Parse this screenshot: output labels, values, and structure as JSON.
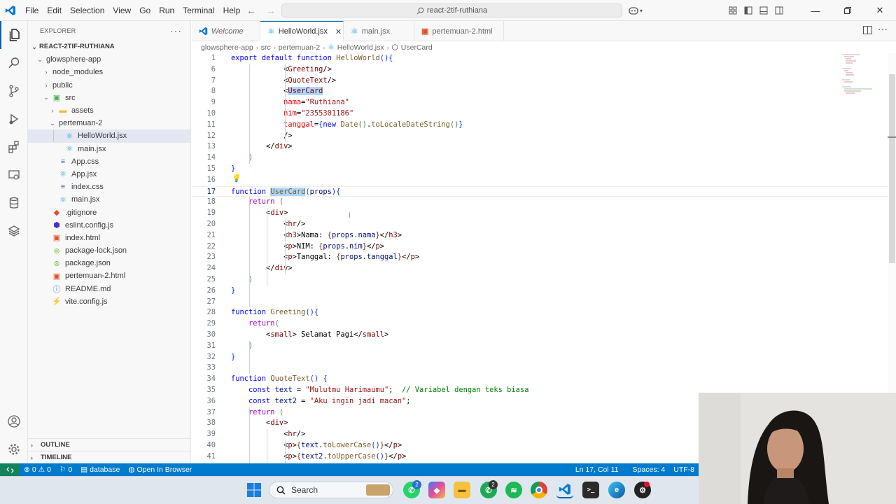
{
  "menu": [
    "File",
    "Edit",
    "Selection",
    "View",
    "Go",
    "Run",
    "Terminal",
    "Help"
  ],
  "command_center": "react-2tif-ruthiana",
  "explorer": {
    "title": "EXPLORER",
    "root": "REACT-2TIF-RUTHIANA",
    "items": [
      {
        "name": "glowsphere-app",
        "depth": 0,
        "type": "folder",
        "open": true
      },
      {
        "name": "node_modules",
        "depth": 1,
        "type": "folder",
        "open": false
      },
      {
        "name": "public",
        "depth": 1,
        "type": "folder",
        "open": false
      },
      {
        "name": "src",
        "depth": 1,
        "type": "folder-src",
        "open": true
      },
      {
        "name": "assets",
        "depth": 2,
        "type": "folder-assets",
        "open": false
      },
      {
        "name": "pertemuan-2",
        "depth": 2,
        "type": "folder",
        "open": true
      },
      {
        "name": "HelloWorld.jsx",
        "depth": 3,
        "type": "react",
        "selected": true
      },
      {
        "name": "main.jsx",
        "depth": 3,
        "type": "react"
      },
      {
        "name": "App.css",
        "depth": 2,
        "type": "css"
      },
      {
        "name": "App.jsx",
        "depth": 2,
        "type": "react"
      },
      {
        "name": "index.css",
        "depth": 2,
        "type": "css"
      },
      {
        "name": "main.jsx",
        "depth": 2,
        "type": "react"
      },
      {
        "name": ".gitignore",
        "depth": 1,
        "type": "git"
      },
      {
        "name": "eslint.config.js",
        "depth": 1,
        "type": "eslint"
      },
      {
        "name": "index.html",
        "depth": 1,
        "type": "html"
      },
      {
        "name": "package-lock.json",
        "depth": 1,
        "type": "npm"
      },
      {
        "name": "package.json",
        "depth": 1,
        "type": "npm"
      },
      {
        "name": "pertemuan-2.html",
        "depth": 1,
        "type": "html"
      },
      {
        "name": "README.md",
        "depth": 1,
        "type": "info"
      },
      {
        "name": "vite.config.js",
        "depth": 1,
        "type": "vite"
      }
    ],
    "outline": "OUTLINE",
    "timeline": "TIMELINE"
  },
  "tabs": [
    {
      "label": "Welcome",
      "icon": "vscode-icon",
      "italic": true
    },
    {
      "label": "HelloWorld.jsx",
      "icon": "react-icon",
      "active": true,
      "close": "✕"
    },
    {
      "label": "main.jsx",
      "icon": "react-icon"
    },
    {
      "label": "pertemuan-2.html",
      "icon": "html-icon"
    }
  ],
  "breadcrumb": [
    "glowsphere-app",
    "src",
    "pertemuan-2",
    "HelloWorld.jsx",
    "UserCard"
  ],
  "editor": {
    "current_line": 17,
    "lines": [
      {
        "n": "1",
        "html": "<span class='k'>export</span> <span class='k'>default</span> <span class='k'>function</span> <span class='f'>HelloWorld</span><span class='b1'>()</span><span class='b1'>{</span>"
      },
      {
        "n": "6",
        "html": "            <span class='p'>&lt;</span><span class='t'>Greeting</span><span class='p'>/&gt;</span>"
      },
      {
        "n": "7",
        "html": "            <span class='p'>&lt;</span><span class='t'>QuoteText</span><span class='p'>/&gt;</span>"
      },
      {
        "n": "8",
        "html": "            <span class='p'>&lt;</span><span class='t hl'>UserCard</span>"
      },
      {
        "n": "9",
        "html": "            <span class='a'>nama</span><span class='p'>=</span><span class='s'>\"Ruthiana\"</span>"
      },
      {
        "n": "10",
        "html": "            <span class='a'>nim</span><span class='p'>=</span><span class='s'>\"2355301186\"</span>"
      },
      {
        "n": "11",
        "html": "            <span class='a'>tanggal</span><span class='p'>=</span><span class='b1'>{</span><span class='k'>new</span> <span class='f'>Date</span><span class='b2'>()</span>.<span class='f'>toLocaleDateString</span><span class='b2'>()</span><span class='b1'>}</span>"
      },
      {
        "n": "12",
        "html": "            <span class='p'>/&gt;</span>"
      },
      {
        "n": "13",
        "html": "        <span class='p'>&lt;/</span><span class='t'>div</span><span class='p'>&gt;</span>"
      },
      {
        "n": "14",
        "html": "    <span class='b2'>)</span>"
      },
      {
        "n": "15",
        "html": "<span class='b1'>}</span>"
      },
      {
        "n": "16",
        "html": ""
      },
      {
        "n": "17",
        "html": "<span class='k'>function</span> <span class='f hl'>UserCard</span><span class='b1'>(</span><span class='v'>props</span><span class='b1'>)</span><span class='b1'>{</span>"
      },
      {
        "n": "18",
        "html": "    <span class='kc'>return</span> <span class='b2'>(</span>"
      },
      {
        "n": "19",
        "html": "        <span class='p'>&lt;</span><span class='t'>div</span><span class='p'>&gt;</span>"
      },
      {
        "n": "20",
        "html": "            <span class='p'>&lt;</span><span class='t'>hr</span><span class='p'>/&gt;</span>"
      },
      {
        "n": "21",
        "html": "            <span class='p'>&lt;</span><span class='t'>h3</span><span class='p'>&gt;</span>Nama: <span class='b3'>{</span><span class='v'>props</span>.<span class='v'>nama</span><span class='b3'>}</span><span class='p'>&lt;/</span><span class='t'>h3</span><span class='p'>&gt;</span>"
      },
      {
        "n": "22",
        "html": "            <span class='p'>&lt;</span><span class='t'>p</span><span class='p'>&gt;</span>NIM: <span class='b3'>{</span><span class='v'>props</span>.<span class='v'>nim</span><span class='b3'>}</span><span class='p'>&lt;/</span><span class='t'>p</span><span class='p'>&gt;</span>"
      },
      {
        "n": "23",
        "html": "            <span class='p'>&lt;</span><span class='t'>p</span><span class='p'>&gt;</span>Tanggal: <span class='b3'>{</span><span class='v'>props</span>.<span class='v'>tanggal</span><span class='b3'>}</span><span class='p'>&lt;/</span><span class='t'>p</span><span class='p'>&gt;</span>"
      },
      {
        "n": "24",
        "html": "        <span class='p'>&lt;/</span><span class='t'>div</span><span class='p'>&gt;</span>"
      },
      {
        "n": "25",
        "html": "    <span class='b2'>)</span>"
      },
      {
        "n": "26",
        "html": "<span class='b1'>}</span>"
      },
      {
        "n": "27",
        "html": ""
      },
      {
        "n": "28",
        "html": "<span class='k'>function</span> <span class='f'>Greeting</span><span class='b1'>()</span><span class='b1'>{</span>"
      },
      {
        "n": "29",
        "html": "    <span class='kc'>return</span><span class='b2'>(</span>"
      },
      {
        "n": "30",
        "html": "        <span class='p'>&lt;</span><span class='t'>small</span><span class='p'>&gt;</span> Selamat Pagi<span class='p'>&lt;/</span><span class='t'>small</span><span class='p'>&gt;</span>"
      },
      {
        "n": "31",
        "html": "    <span class='b2'>)</span>"
      },
      {
        "n": "32",
        "html": "<span class='b1'>}</span>"
      },
      {
        "n": "33",
        "html": ""
      },
      {
        "n": "34",
        "html": "<span class='k'>function</span> <span class='f'>QuoteText</span><span class='b1'>()</span> <span class='b1'>{</span>"
      },
      {
        "n": "35",
        "html": "    <span class='k'>const</span> <span class='v'>text</span> = <span class='s'>\"Mulutmu Harimaumu\"</span>;  <span class='c'>// Variabel dengan teks biasa</span>"
      },
      {
        "n": "36",
        "html": "    <span class='k'>const</span> <span class='v'>text2</span> = <span class='s'>\"Aku ingin jadi macan\"</span>;"
      },
      {
        "n": "37",
        "html": "    <span class='kc'>return</span> <span class='b2'>(</span>"
      },
      {
        "n": "38",
        "html": "        <span class='p'>&lt;</span><span class='t'>div</span><span class='p'>&gt;</span>"
      },
      {
        "n": "39",
        "html": "            <span class='p'>&lt;</span><span class='t'>hr</span><span class='p'>/&gt;</span>"
      },
      {
        "n": "40",
        "html": "            <span class='p'>&lt;</span><span class='t'>p</span><span class='p'>&gt;</span><span class='b3'>{</span><span class='v'>text</span>.<span class='f'>toLowerCase</span><span class='b1'>()</span><span class='b3'>}</span><span class='p'>&lt;/</span><span class='t'>p</span><span class='p'>&gt;</span>"
      },
      {
        "n": "41",
        "html": "            <span class='p'>&lt;</span><span class='t'>p</span><span class='p'>&gt;</span><span class='b3'>{</span><span class='v'>text2</span>.<span class='f'>toUpperCase</span><span class='b1'>()</span><span class='b3'>}</span><span class='p'>&lt;/</span><span class='t'>p</span><span class='p'>&gt;</span>"
      }
    ]
  },
  "status": {
    "errors": "0",
    "warnings": "0",
    "ports": "0",
    "database": "database",
    "open_browser": "Open In Browser",
    "position": "Ln 17, Col 11",
    "spaces": "Spaces: 4",
    "encoding": "UTF-8"
  },
  "taskbar": {
    "search": "Search",
    "badge_whatsapp": "2",
    "badge_whatsapp2": "2"
  },
  "colors": {
    "accent": "#005fb8",
    "statusbar": "#007acc",
    "remote": "#16825d"
  }
}
